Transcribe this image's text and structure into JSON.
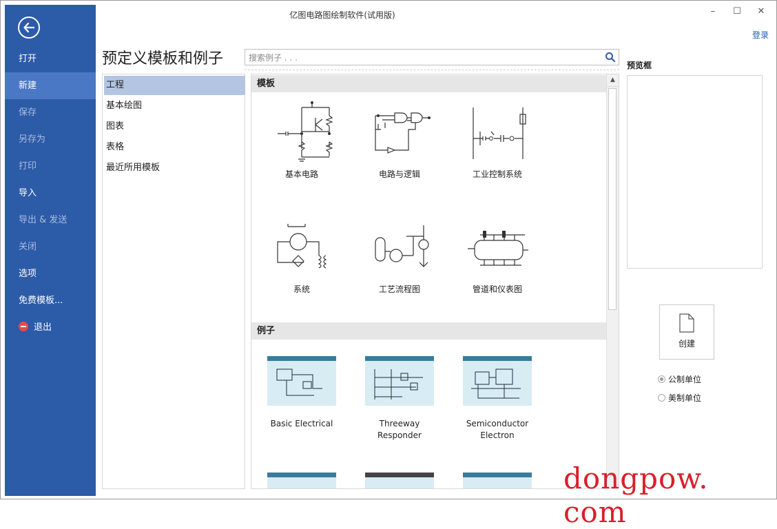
{
  "window": {
    "title": "亿图电路图绘制软件(试用版)",
    "login": "登录",
    "minimize_glyph": "–",
    "maximize_glyph": "☐",
    "close_glyph": "✕"
  },
  "sidebar": {
    "back_icon": "back-arrow-icon",
    "items": [
      {
        "label": "打开",
        "state": "normal"
      },
      {
        "label": "新建",
        "state": "active"
      },
      {
        "label": "保存",
        "state": "disabled"
      },
      {
        "label": "另存为",
        "state": "disabled"
      },
      {
        "label": "打印",
        "state": "disabled"
      },
      {
        "label": "导入",
        "state": "normal"
      },
      {
        "label": "导出 & 发送",
        "state": "disabled"
      },
      {
        "label": "关闭",
        "state": "disabled"
      },
      {
        "label": "选项",
        "state": "normal"
      },
      {
        "label": "免费模板...",
        "state": "normal"
      },
      {
        "label": "退出",
        "state": "normal",
        "icon": "exit-icon"
      }
    ]
  },
  "main": {
    "page_title": "预定义模板和例子",
    "search": {
      "placeholder": "搜索例子 . . .",
      "value": "",
      "icon": "search-icon"
    }
  },
  "categories": [
    {
      "label": "工程",
      "selected": true
    },
    {
      "label": "基本绘图",
      "selected": false
    },
    {
      "label": "图表",
      "selected": false
    },
    {
      "label": "表格",
      "selected": false
    },
    {
      "label": "最近所用模板",
      "selected": false
    }
  ],
  "templates": {
    "header": "模板",
    "items": [
      "基本电路",
      "电路与逻辑",
      "工业控制系统",
      "系统",
      "工艺流程图",
      "管道和仪表图"
    ]
  },
  "examples": {
    "header": "例子",
    "items": [
      "Basic Electrical",
      "Threeway\nResponder",
      "Semiconductor\nElectron"
    ]
  },
  "right_panel": {
    "preview_label": "预览框",
    "create_label": "创建",
    "units": [
      {
        "label": "公制单位",
        "checked": true
      },
      {
        "label": "美制单位",
        "checked": false
      }
    ]
  },
  "watermark": "dongpow. com",
  "colors": {
    "sidebar": "#2c5ba8",
    "sidebar_active": "#4a78c4",
    "selected_category": "#b4c5e4",
    "watermark": "#d8202a",
    "exit": "#e34b4b"
  }
}
